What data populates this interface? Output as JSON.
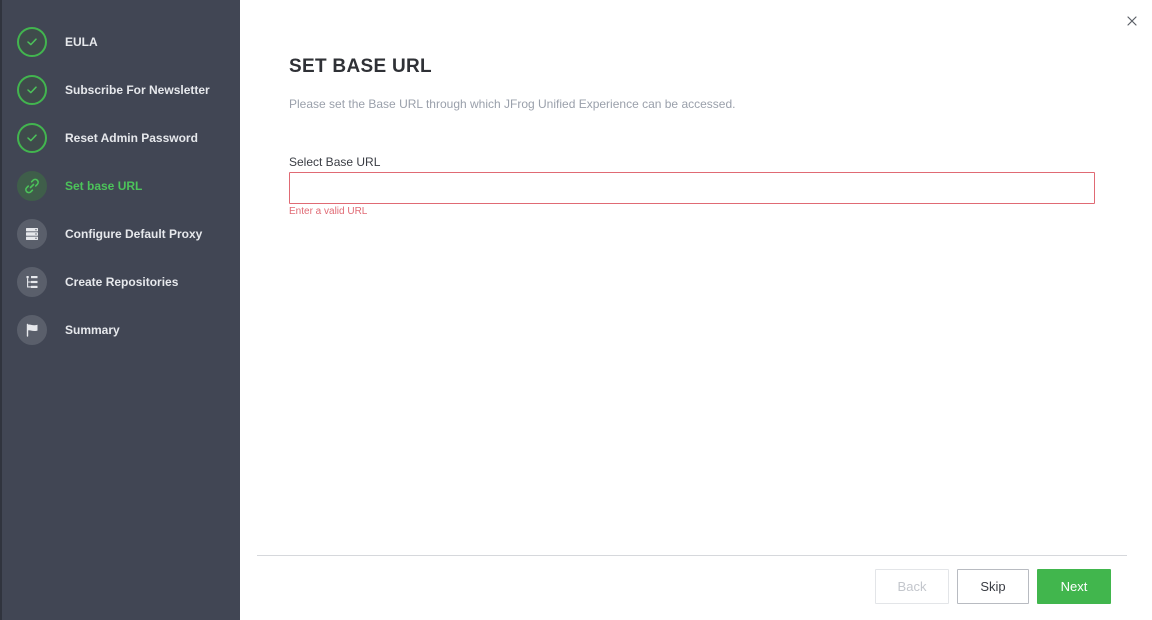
{
  "wizard": {
    "steps": [
      {
        "label": "EULA",
        "state": "done",
        "icon": "check-icon"
      },
      {
        "label": "Subscribe For Newsletter",
        "state": "done",
        "icon": "check-icon"
      },
      {
        "label": "Reset Admin Password",
        "state": "done",
        "icon": "check-icon"
      },
      {
        "label": "Set base URL",
        "state": "active",
        "icon": "link-icon"
      },
      {
        "label": "Configure Default Proxy",
        "state": "pending",
        "icon": "server-icon"
      },
      {
        "label": "Create Repositories",
        "state": "pending",
        "icon": "repository-tree-icon"
      },
      {
        "label": "Summary",
        "state": "pending",
        "icon": "flag-icon"
      }
    ]
  },
  "page": {
    "title": "SET BASE URL",
    "subtitle": "Please set the Base URL through which JFrog Unified Experience can be accessed.",
    "field": {
      "label": "Select Base URL",
      "value": "",
      "error": "Enter a valid URL"
    }
  },
  "footer": {
    "back_label": "Back",
    "skip_label": "Skip",
    "next_label": "Next"
  },
  "colors": {
    "sidebar_bg": "#414654",
    "accent_green": "#41b64d",
    "error_red": "#e06a74"
  }
}
